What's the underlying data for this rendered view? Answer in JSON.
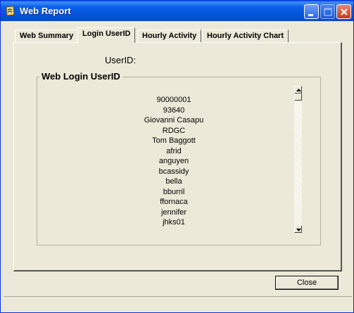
{
  "window": {
    "title": "Web Report",
    "icon": "app-icon"
  },
  "tabs": [
    {
      "label": "Web Summary",
      "active": false
    },
    {
      "label": "Login UserID",
      "active": true
    },
    {
      "label": "Hourly Activity",
      "active": false
    },
    {
      "label": "Hourly Activity  Chart",
      "active": false
    }
  ],
  "main": {
    "userid_label": "UserID:",
    "group_title": "Web Login UserID",
    "user_list": [
      "90000001",
      "93640",
      "Giovanni Casapu",
      "RDGC",
      "Tom Baggott",
      "afrid",
      "anguyen",
      "bcassidy",
      "bella",
      "bburril",
      "ffornaca",
      "jennifer",
      "jhks01"
    ]
  },
  "footer": {
    "close_label": "Close"
  }
}
